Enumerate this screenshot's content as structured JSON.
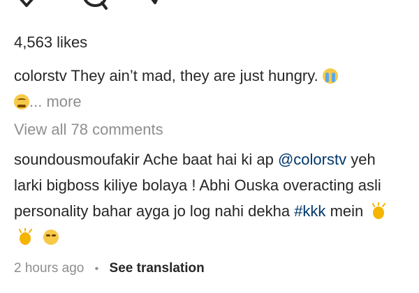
{
  "post": {
    "likes_text": "4,563 likes",
    "caption": {
      "username": "colorstv",
      "text": "They ain’t mad, they are just hungry.",
      "more_label": "... more",
      "emojis": [
        "loudly-crying-face",
        "face-with-steam"
      ]
    },
    "view_comments_label": "View all 78 comments",
    "comment": {
      "username": "soundousmoufakir",
      "text_part1": "Ache baat hai ki ap",
      "mention": "@colorstv",
      "text_part2": "yeh larki bigboss kiliye bolaya ! Abhi Ouska overacting asli personality bahar ayga jo log nahi dekha",
      "hashtag": "#kkk",
      "text_part3": "mein",
      "emojis": [
        "clapping-hands",
        "clapping-hands",
        "unamused-face"
      ]
    },
    "meta": {
      "timestamp": "2 hours ago",
      "separator": "•",
      "translate_label": "See translation"
    }
  },
  "icons": [
    "heart-icon",
    "comment-icon",
    "share-icon"
  ],
  "colors": {
    "text": "#262626",
    "muted": "#8e8e8e",
    "link": "#00376b"
  }
}
